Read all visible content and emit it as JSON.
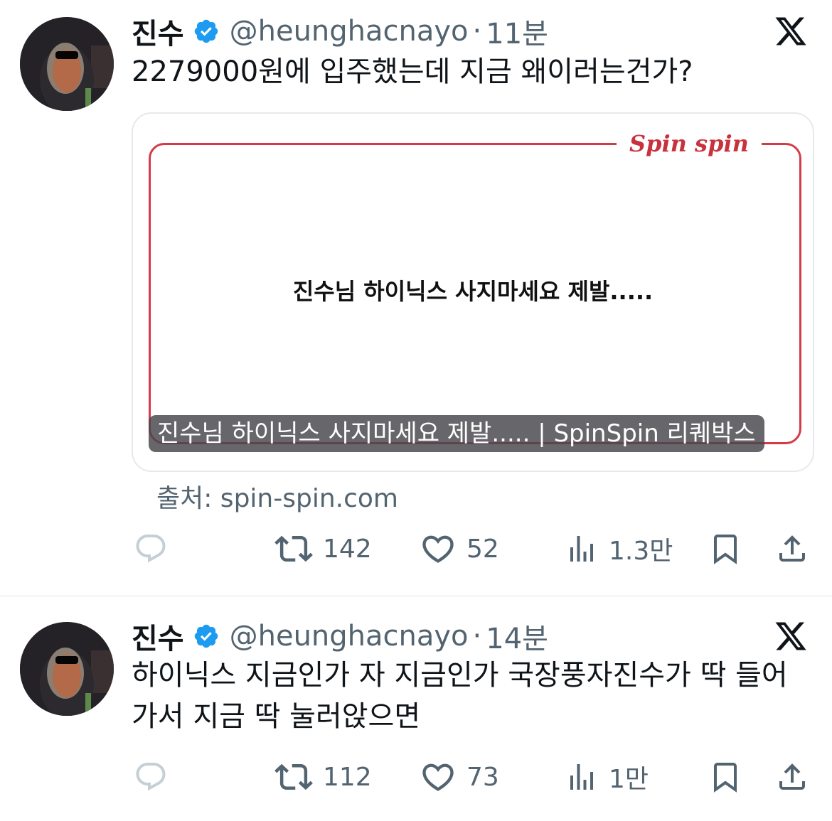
{
  "tweets": [
    {
      "author_name": "진수",
      "handle": "@heunghacnayo",
      "separator": "·",
      "time": "11분",
      "text": "2279000원에 입주했는데 지금 왜이러는건가?",
      "card": {
        "logo": "Spin spin",
        "body_text": "진수님 하이닉스 사지마세요 제발.....",
        "caption": "진수님 하이닉스 사지마세요 제발..... | SpinSpin 리퀘박스"
      },
      "source": "출처: spin-spin.com",
      "stats": {
        "retweets": "142",
        "likes": "52",
        "views": "1.3만"
      }
    },
    {
      "author_name": "진수",
      "handle": "@heunghacnayo",
      "separator": "·",
      "time": "14분",
      "text_line1": "하이닉스 지금인가 자 지금인가 국장풍자진수가 딱 들어",
      "text_line2": "가서 지금 딱 눌러앉으면",
      "stats": {
        "retweets": "112",
        "likes": "73",
        "views": "1만"
      }
    }
  ],
  "icons": {
    "verified": "verified-badge-icon",
    "x_logo": "x-logo-icon",
    "reply": "reply-icon",
    "retweet": "retweet-icon",
    "like": "heart-icon",
    "views": "views-icon",
    "bookmark": "bookmark-icon",
    "share": "share-icon"
  },
  "colors": {
    "verified": "#1d9bf0",
    "text": "#0f1419",
    "secondary": "#536471",
    "card_accent": "#d23c4a"
  }
}
